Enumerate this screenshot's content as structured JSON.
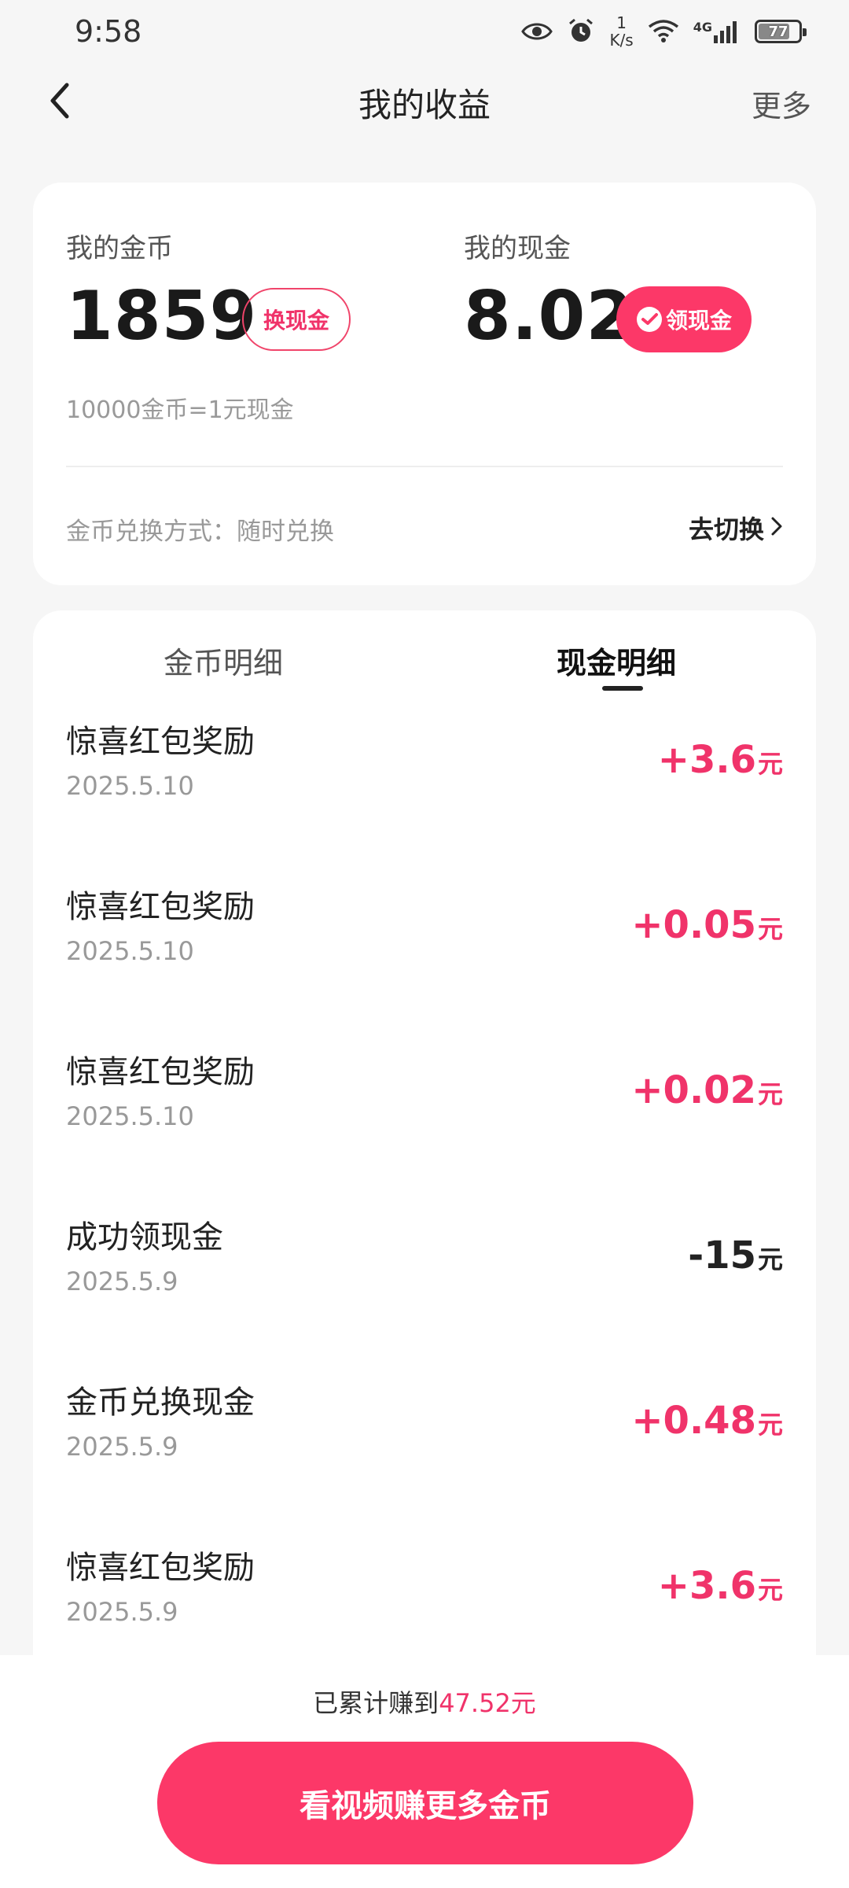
{
  "status_bar": {
    "time": "9:58",
    "net_speed_value": "1",
    "net_speed_unit": "K/s",
    "network_type": "4G",
    "battery": "77",
    "battery_level": 0.77
  },
  "header": {
    "title": "我的收益",
    "more_label": "更多"
  },
  "balance": {
    "coins_label": "我的金币",
    "coins_value": "1859",
    "exchange_button": "换现金",
    "cash_label": "我的现金",
    "cash_value": "8.02",
    "withdraw_button": "领现金",
    "rate_note": "10000金币=1元现金",
    "mode_label": "金币兑换方式：随时兑换",
    "mode_switch": "去切换"
  },
  "tabs": {
    "coins_detail": "金币明细",
    "cash_detail": "现金明细",
    "active": "cash_detail"
  },
  "transactions": [
    {
      "title": "惊喜红包奖励",
      "date": "2025.5.10",
      "amount": "+3.6",
      "unit": "元",
      "positive": true
    },
    {
      "title": "惊喜红包奖励",
      "date": "2025.5.10",
      "amount": "+0.05",
      "unit": "元",
      "positive": true
    },
    {
      "title": "惊喜红包奖励",
      "date": "2025.5.10",
      "amount": "+0.02",
      "unit": "元",
      "positive": true
    },
    {
      "title": "成功领现金",
      "date": "2025.5.9",
      "amount": "-15",
      "unit": "元",
      "positive": false
    },
    {
      "title": "金币兑换现金",
      "date": "2025.5.9",
      "amount": "+0.48",
      "unit": "元",
      "positive": true
    },
    {
      "title": "惊喜红包奖励",
      "date": "2025.5.9",
      "amount": "+3.6",
      "unit": "元",
      "positive": true
    }
  ],
  "footer": {
    "total_prefix": "已累计赚到",
    "total_amount": "47.52元",
    "cta_button": "看视频赚更多金币"
  },
  "colors": {
    "accent": "#fc3868",
    "positive_amount": "#f0336a",
    "background": "#f6f6f6"
  }
}
